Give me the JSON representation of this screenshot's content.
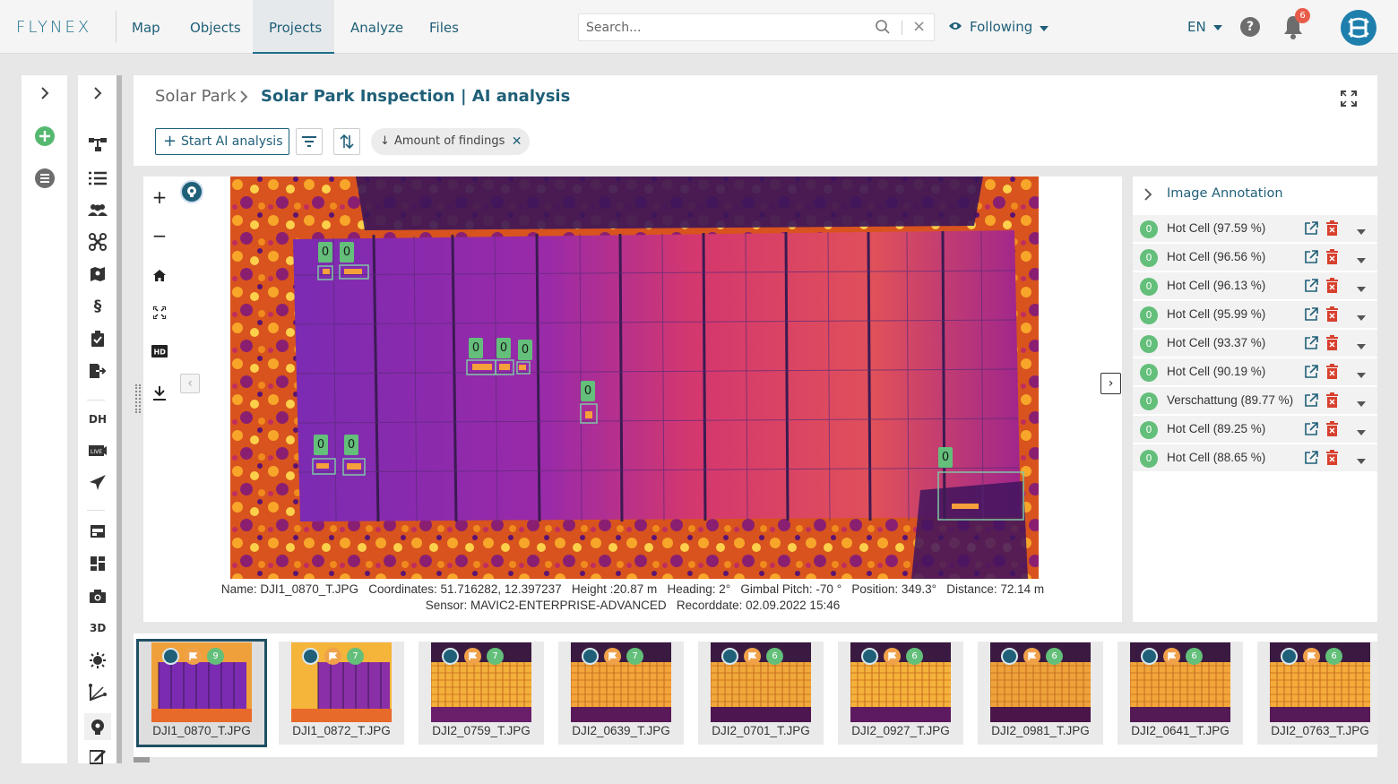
{
  "brand": {
    "logo_text": "FLYNEX"
  },
  "nav": {
    "items": [
      {
        "label": "Map"
      },
      {
        "label": "Objects"
      },
      {
        "label": "Projects"
      },
      {
        "label": "Analyze"
      },
      {
        "label": "Files"
      }
    ],
    "active_item": "Projects",
    "search": {
      "placeholder": "Search..."
    },
    "following_label": "Following",
    "language": "EN",
    "notification_count": "6",
    "accent_color": "#1f5f78"
  },
  "leftbar": {
    "text_items": {
      "dh": "DH",
      "three_d": "3D"
    }
  },
  "header": {
    "breadcrumb_root": "Solar Park",
    "breadcrumb_current": "Solar Park Inspection | AI analysis",
    "start_ai_label": "Start AI analysis",
    "sort_chip_label": "Amount of findings"
  },
  "viewer": {
    "markers": [
      {
        "label": "0"
      },
      {
        "label": "0"
      },
      {
        "label": "0"
      },
      {
        "label": "0"
      },
      {
        "label": "0"
      },
      {
        "label": "0"
      },
      {
        "label": "0"
      },
      {
        "label": "0"
      },
      {
        "label": "0"
      }
    ],
    "meta_line1": "Name: DJI1_0870_T.JPG   Coordinates: 51.716282, 12.397237   Height :20.87 m   Heading: 2°   Gimbal Pitch: -70 °   Position: 349.3°   Distance: 72.14 m",
    "meta_line2": "Sensor: MAVIC2-ENTERPRISE-ADVANCED   Recorddate: 02.09.2022 15:46"
  },
  "annotation": {
    "title": "Image Annotation",
    "items": [
      {
        "count": "0",
        "label": "Hot Cell (97.59 %)"
      },
      {
        "count": "0",
        "label": "Hot Cell (96.56 %)"
      },
      {
        "count": "0",
        "label": "Hot Cell (96.13 %)"
      },
      {
        "count": "0",
        "label": "Hot Cell (95.99 %)"
      },
      {
        "count": "0",
        "label": "Hot Cell (93.37 %)"
      },
      {
        "count": "0",
        "label": "Hot Cell (90.19 %)"
      },
      {
        "count": "0",
        "label": "Verschattung (89.77 %)"
      },
      {
        "count": "0",
        "label": "Hot Cell (89.25 %)"
      },
      {
        "count": "0",
        "label": "Hot Cell (88.65 %)"
      }
    ]
  },
  "filmstrip": {
    "images": [
      {
        "name": "DJI1_0870_T.JPG",
        "count": "9",
        "selected": true
      },
      {
        "name": "DJI1_0872_T.JPG",
        "count": "7"
      },
      {
        "name": "DJI2_0759_T.JPG",
        "count": "7"
      },
      {
        "name": "DJI2_0639_T.JPG",
        "count": "7"
      },
      {
        "name": "DJI2_0701_T.JPG",
        "count": "6"
      },
      {
        "name": "DJI2_0927_T.JPG",
        "count": "6"
      },
      {
        "name": "DJI2_0981_T.JPG",
        "count": "6"
      },
      {
        "name": "DJI2_0641_T.JPG",
        "count": "6"
      },
      {
        "name": "DJI2_0763_T.JPG",
        "count": "6"
      }
    ]
  }
}
